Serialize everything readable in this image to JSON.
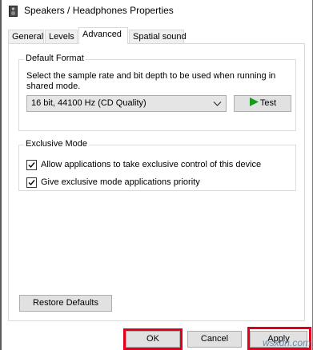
{
  "window": {
    "title": "Speakers / Headphones Properties",
    "icon": "speaker-icon"
  },
  "tabs": [
    {
      "label": "General",
      "active": false
    },
    {
      "label": "Levels",
      "active": false
    },
    {
      "label": "Advanced",
      "active": true
    },
    {
      "label": "Spatial sound",
      "active": false
    }
  ],
  "default_format": {
    "group_label": "Default Format",
    "description": "Select the sample rate and bit depth to be used when running in shared mode.",
    "selected": "16 bit, 44100 Hz (CD Quality)",
    "test_label": "Test",
    "test_icon": "play-icon",
    "test_icon_color": "#1a9a1a"
  },
  "exclusive_mode": {
    "group_label": "Exclusive Mode",
    "options": [
      {
        "label": "Allow applications to take exclusive control of this device",
        "checked": true
      },
      {
        "label": "Give exclusive mode applications priority",
        "checked": true
      }
    ]
  },
  "buttons": {
    "restore_defaults": "Restore Defaults",
    "ok": "OK",
    "cancel": "Cancel",
    "apply": "Apply"
  },
  "highlight_color": "#e0001b",
  "watermark": "wsxdn.com"
}
